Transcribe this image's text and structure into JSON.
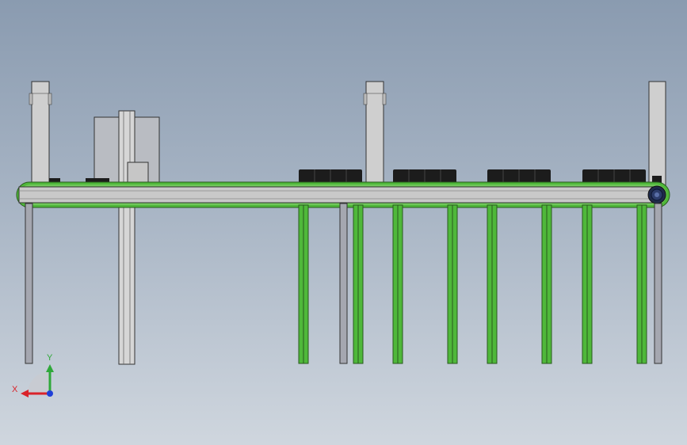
{
  "viewport": {
    "name": "cad-3d-viewport",
    "view": "front"
  },
  "model": {
    "name": "conveyor-assembly",
    "colors": {
      "belt_green": "#4fb83a",
      "belt_dark": "#2a5a1e",
      "frame_grey": "#c8c8c8",
      "frame_edge": "#3a3a3a",
      "leg_grey": "#9a9ca6",
      "block_black": "#1c1c1c",
      "roller_blue": "#2c3c6a"
    },
    "counts": {
      "uprights": 3,
      "black_blocks": 4,
      "green_belt_strands": 7
    }
  },
  "triad": {
    "x_label": "X",
    "y_label": "Y",
    "x_color": "#d9232a",
    "y_color": "#2fa83a",
    "z_color": "#1f3fd8"
  }
}
